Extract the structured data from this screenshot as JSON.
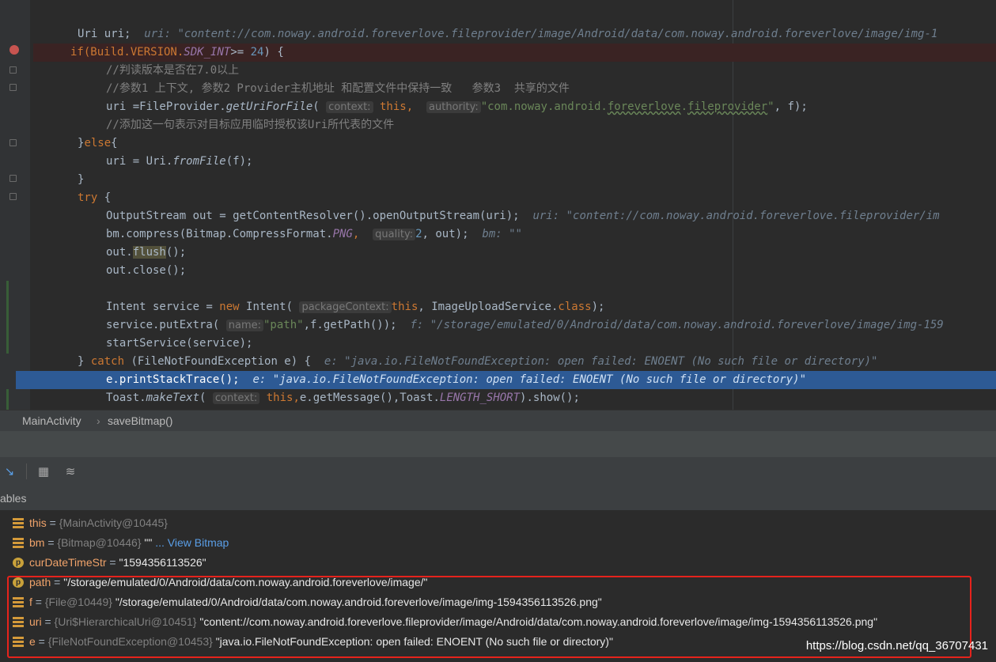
{
  "editor": {
    "lines": [
      {
        "id": "l0",
        "html": ""
      },
      {
        "id": "l1"
      },
      {
        "id": "l2"
      }
    ],
    "uri_decl": "Uri uri;",
    "uri_decl_hint": "uri: \"content://com.noway.android.foreverlove.fileprovider/image/Android/data/com.noway.android.foreverlove/image/img-1",
    "if_line": "if(Build.VERSION.",
    "sdk_int": "SDK_INT",
    "if_rest": ">= ",
    "if_num": "24",
    "if_end": ") {",
    "comment1": "//判读版本是否在7.0以上",
    "comment2": "//参数1 上下文, 参数2 Provider主机地址 和配置文件中保持一致   参数3  共享的文件",
    "uri_assign_a": "uri =FileProvider.",
    "get_uri_for_file": "getUriForFile",
    "paren_open": "(",
    "hint_context": "context:",
    "this_kw": "this",
    "comma": ",",
    "hint_authority": "authority:",
    "authority_str_a": "\"com.noway.android.",
    "authority_str_b": "foreverlove",
    "authority_str_c": ".",
    "authority_str_d": "fileprovider",
    "authority_str_e": "\"",
    "uri_assign_end": ", f);",
    "comment3": "//添加这一句表示对目标应用临时授权该Uri所代表的文件",
    "else_a": "}",
    "else_kw": "else",
    "else_b": "{",
    "uri_from_a": "uri = Uri.",
    "from_file": "fromFile",
    "uri_from_b": "(f);",
    "close_brace": "}",
    "try_kw": "try",
    "try_b": " {",
    "out_decl": "OutputStream out = getContentResolver().openOutputStream(uri);",
    "out_decl_hint": "uri: \"content://com.noway.android.foreverlove.fileprovider/im",
    "compress_a": "bm.compress(Bitmap.CompressFormat.",
    "png": "PNG",
    "hint_quality": "quality:",
    "compress_num": "2",
    "compress_b": ", out);",
    "compress_hint": "bm: \"\"",
    "flush_a": "out.",
    "flush_b": "flush",
    "flush_c": "();",
    "close_line": "out.close();",
    "intent_a": "Intent service = ",
    "new_kw": "new",
    "intent_b": " Intent(",
    "hint_package": "packageContext:",
    "intent_c": ", ImageUploadService.",
    "class_kw": "class",
    "intent_d": ");",
    "putextra_a": "service.putExtra(",
    "hint_name": "name:",
    "putextra_str": "\"path\"",
    "putextra_b": ",f.getPath());",
    "putextra_hint": "f: \"/storage/emulated/0/Android/data/com.noway.android.foreverlove/image/img-159",
    "start_service": "startService(service);",
    "catch_a": "} ",
    "catch_kw": "catch",
    "catch_b": " (FileNotFoundException e) {",
    "catch_hint": "e: \"java.io.FileNotFoundException: open failed: ENOENT (No such file or directory)\"",
    "print_stack": "e.printStackTrace();",
    "print_hint": "e: \"java.io.FileNotFoundException: open failed: ENOENT (No such file or directory)\"",
    "toast_a": "Toast.",
    "make_text": "makeText",
    "toast_b": "e.getMessage(),Toast.",
    "length_short": "LENGTH_SHORT",
    "toast_c": ").show();"
  },
  "breadcrumb": {
    "class_name": "MainActivity",
    "separator": "›",
    "method_name": "saveBitmap()"
  },
  "toolbar": {
    "icons": [
      "step-cursor-icon",
      "table-icon",
      "restore-layout-icon"
    ]
  },
  "variables": {
    "header": "ables",
    "rows": [
      {
        "icon": "field",
        "name": "this",
        "type": "{MainActivity@10445}",
        "value": "",
        "link": ""
      },
      {
        "icon": "field",
        "name": "bm",
        "type": "{Bitmap@10446}",
        "value": "\"\"",
        "link": "... View Bitmap"
      },
      {
        "icon": "param",
        "name": "curDateTimeStr",
        "type": "",
        "value": "\"1594356113526\"",
        "link": ""
      },
      {
        "icon": "param",
        "name": "path",
        "type": "",
        "value": "\"/storage/emulated/0/Android/data/com.noway.android.foreverlove/image/\"",
        "link": ""
      },
      {
        "icon": "field",
        "name": "f",
        "type": "{File@10449}",
        "value": "\"/storage/emulated/0/Android/data/com.noway.android.foreverlove/image/img-1594356113526.png\"",
        "link": ""
      },
      {
        "icon": "field",
        "name": "uri",
        "type": "{Uri$HierarchicalUri@10451}",
        "value": "\"content://com.noway.android.foreverlove.fileprovider/image/Android/data/com.noway.android.foreverlove/image/img-1594356113526.png\"",
        "link": ""
      },
      {
        "icon": "field",
        "name": "e",
        "type": "{FileNotFoundException@10453}",
        "value": "\"java.io.FileNotFoundException: open failed: ENOENT (No such file or directory)\"",
        "link": ""
      }
    ]
  },
  "watermark": "https://blog.csdn.net/qq_36707431",
  "colors": {
    "highlight_box": "#e6231c",
    "selection": "#2d5a95"
  }
}
